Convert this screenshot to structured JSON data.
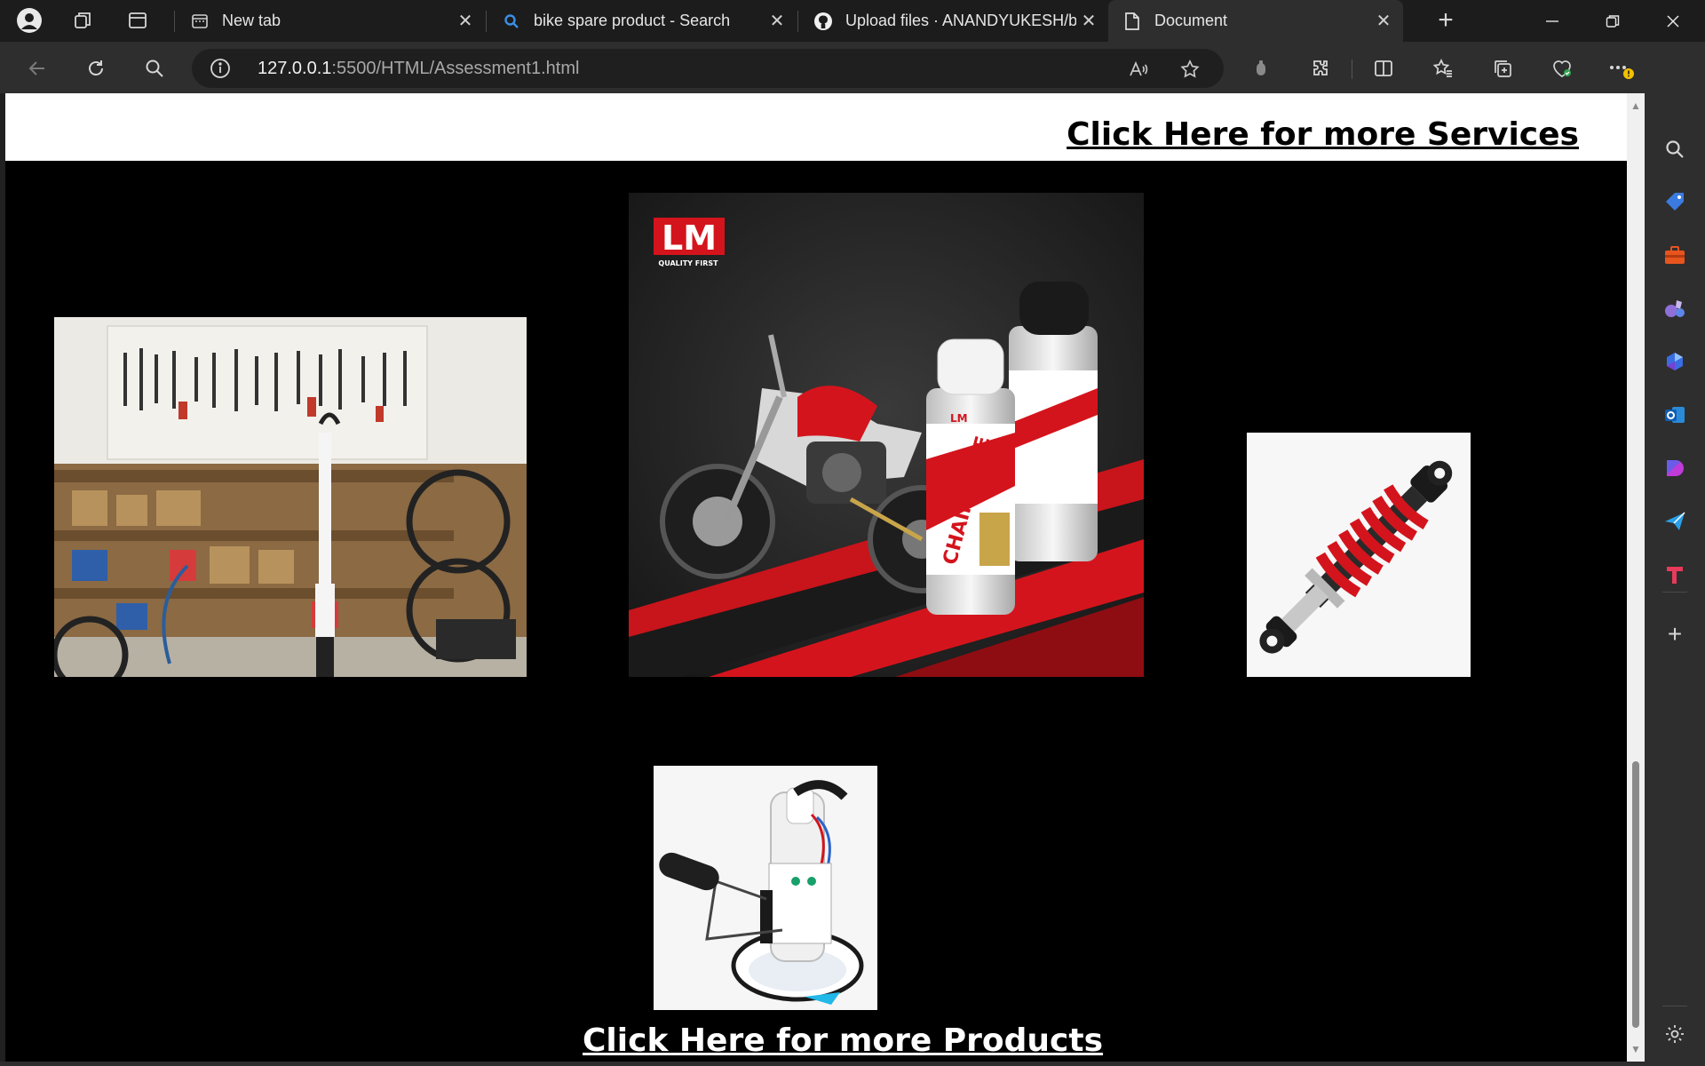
{
  "browser": {
    "tabs": [
      {
        "label": "New tab",
        "icon": "new-tab-page-icon"
      },
      {
        "label": "bike spare product - Search",
        "icon": "search-icon"
      },
      {
        "label": "Upload files · ANANDYUKESH/b",
        "icon": "github-icon"
      },
      {
        "label": "Document",
        "icon": "document-icon"
      }
    ],
    "active_tab": 3,
    "url_host": "127.0.0.1",
    "url_rest": ":5500/HTML/Assessment1.html"
  },
  "page": {
    "services_link": "Click Here for more Services",
    "products_link": "Click Here for more Products",
    "images": [
      {
        "name": "bike-workshop-image",
        "description_icon": "workshop-photo"
      },
      {
        "name": "chain-lube-ad-image",
        "brand": "LM",
        "tagline": "QUALITY FIRST",
        "product": "CHAIN LUBE"
      },
      {
        "name": "shock-absorber-image",
        "description_icon": "shock-absorber-photo"
      },
      {
        "name": "fuel-pump-image",
        "description_icon": "fuel-pump-photo"
      }
    ]
  },
  "colors": {
    "tabbar": "#1c1c1c",
    "toolbar": "#2e2e2e",
    "page_bg": "#000000",
    "band_bg": "#ffffff",
    "accent_red": "#d4141c"
  }
}
